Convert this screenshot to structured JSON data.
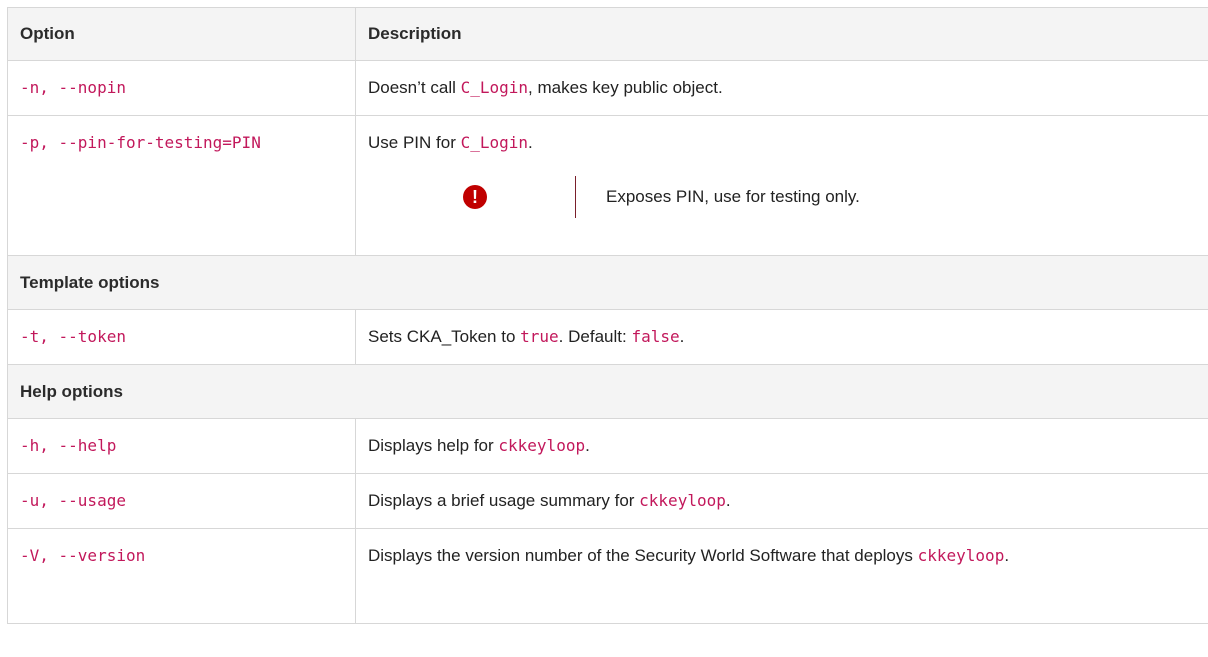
{
  "table": {
    "header": {
      "option": "Option",
      "description": "Description"
    },
    "rows": {
      "nopin": {
        "option": "-n, --nopin",
        "desc_pre": "Doesn’t call ",
        "desc_code": "C_Login",
        "desc_post": ", makes key public object."
      },
      "pin": {
        "option": "-p, --pin-for-testing=PIN",
        "desc_pre": "Use PIN for ",
        "desc_code": "C_Login",
        "desc_post": ".",
        "warning_icon": "exclamation-circle-icon",
        "warning_glyph": "!",
        "warning_text": "Exposes PIN, use for testing only."
      },
      "template_section": {
        "label": "Template options"
      },
      "token": {
        "option": "-t, --token",
        "desc_pre": "Sets CKA_Token to ",
        "desc_code1": "true",
        "desc_mid": ". Default: ",
        "desc_code2": "false",
        "desc_post": "."
      },
      "help_section": {
        "label": "Help options"
      },
      "help": {
        "opt_short": "-h",
        "opt_sep": ", ",
        "opt_long": "--help",
        "desc_pre": "Displays help for ",
        "desc_code": "ckkeyloop",
        "desc_post": "."
      },
      "usage": {
        "opt_short": "-u",
        "opt_sep": ", ",
        "opt_long": "--usage",
        "desc_pre": "Displays a brief usage summary for ",
        "desc_code": "ckkeyloop",
        "desc_post": "."
      },
      "version": {
        "opt_short": "-V",
        "opt_sep": ", ",
        "opt_long": "--version",
        "desc_pre": "Displays the version number of the Security World Software that deploys ",
        "desc_code": "ckkeyloop",
        "desc_post": "."
      }
    }
  }
}
